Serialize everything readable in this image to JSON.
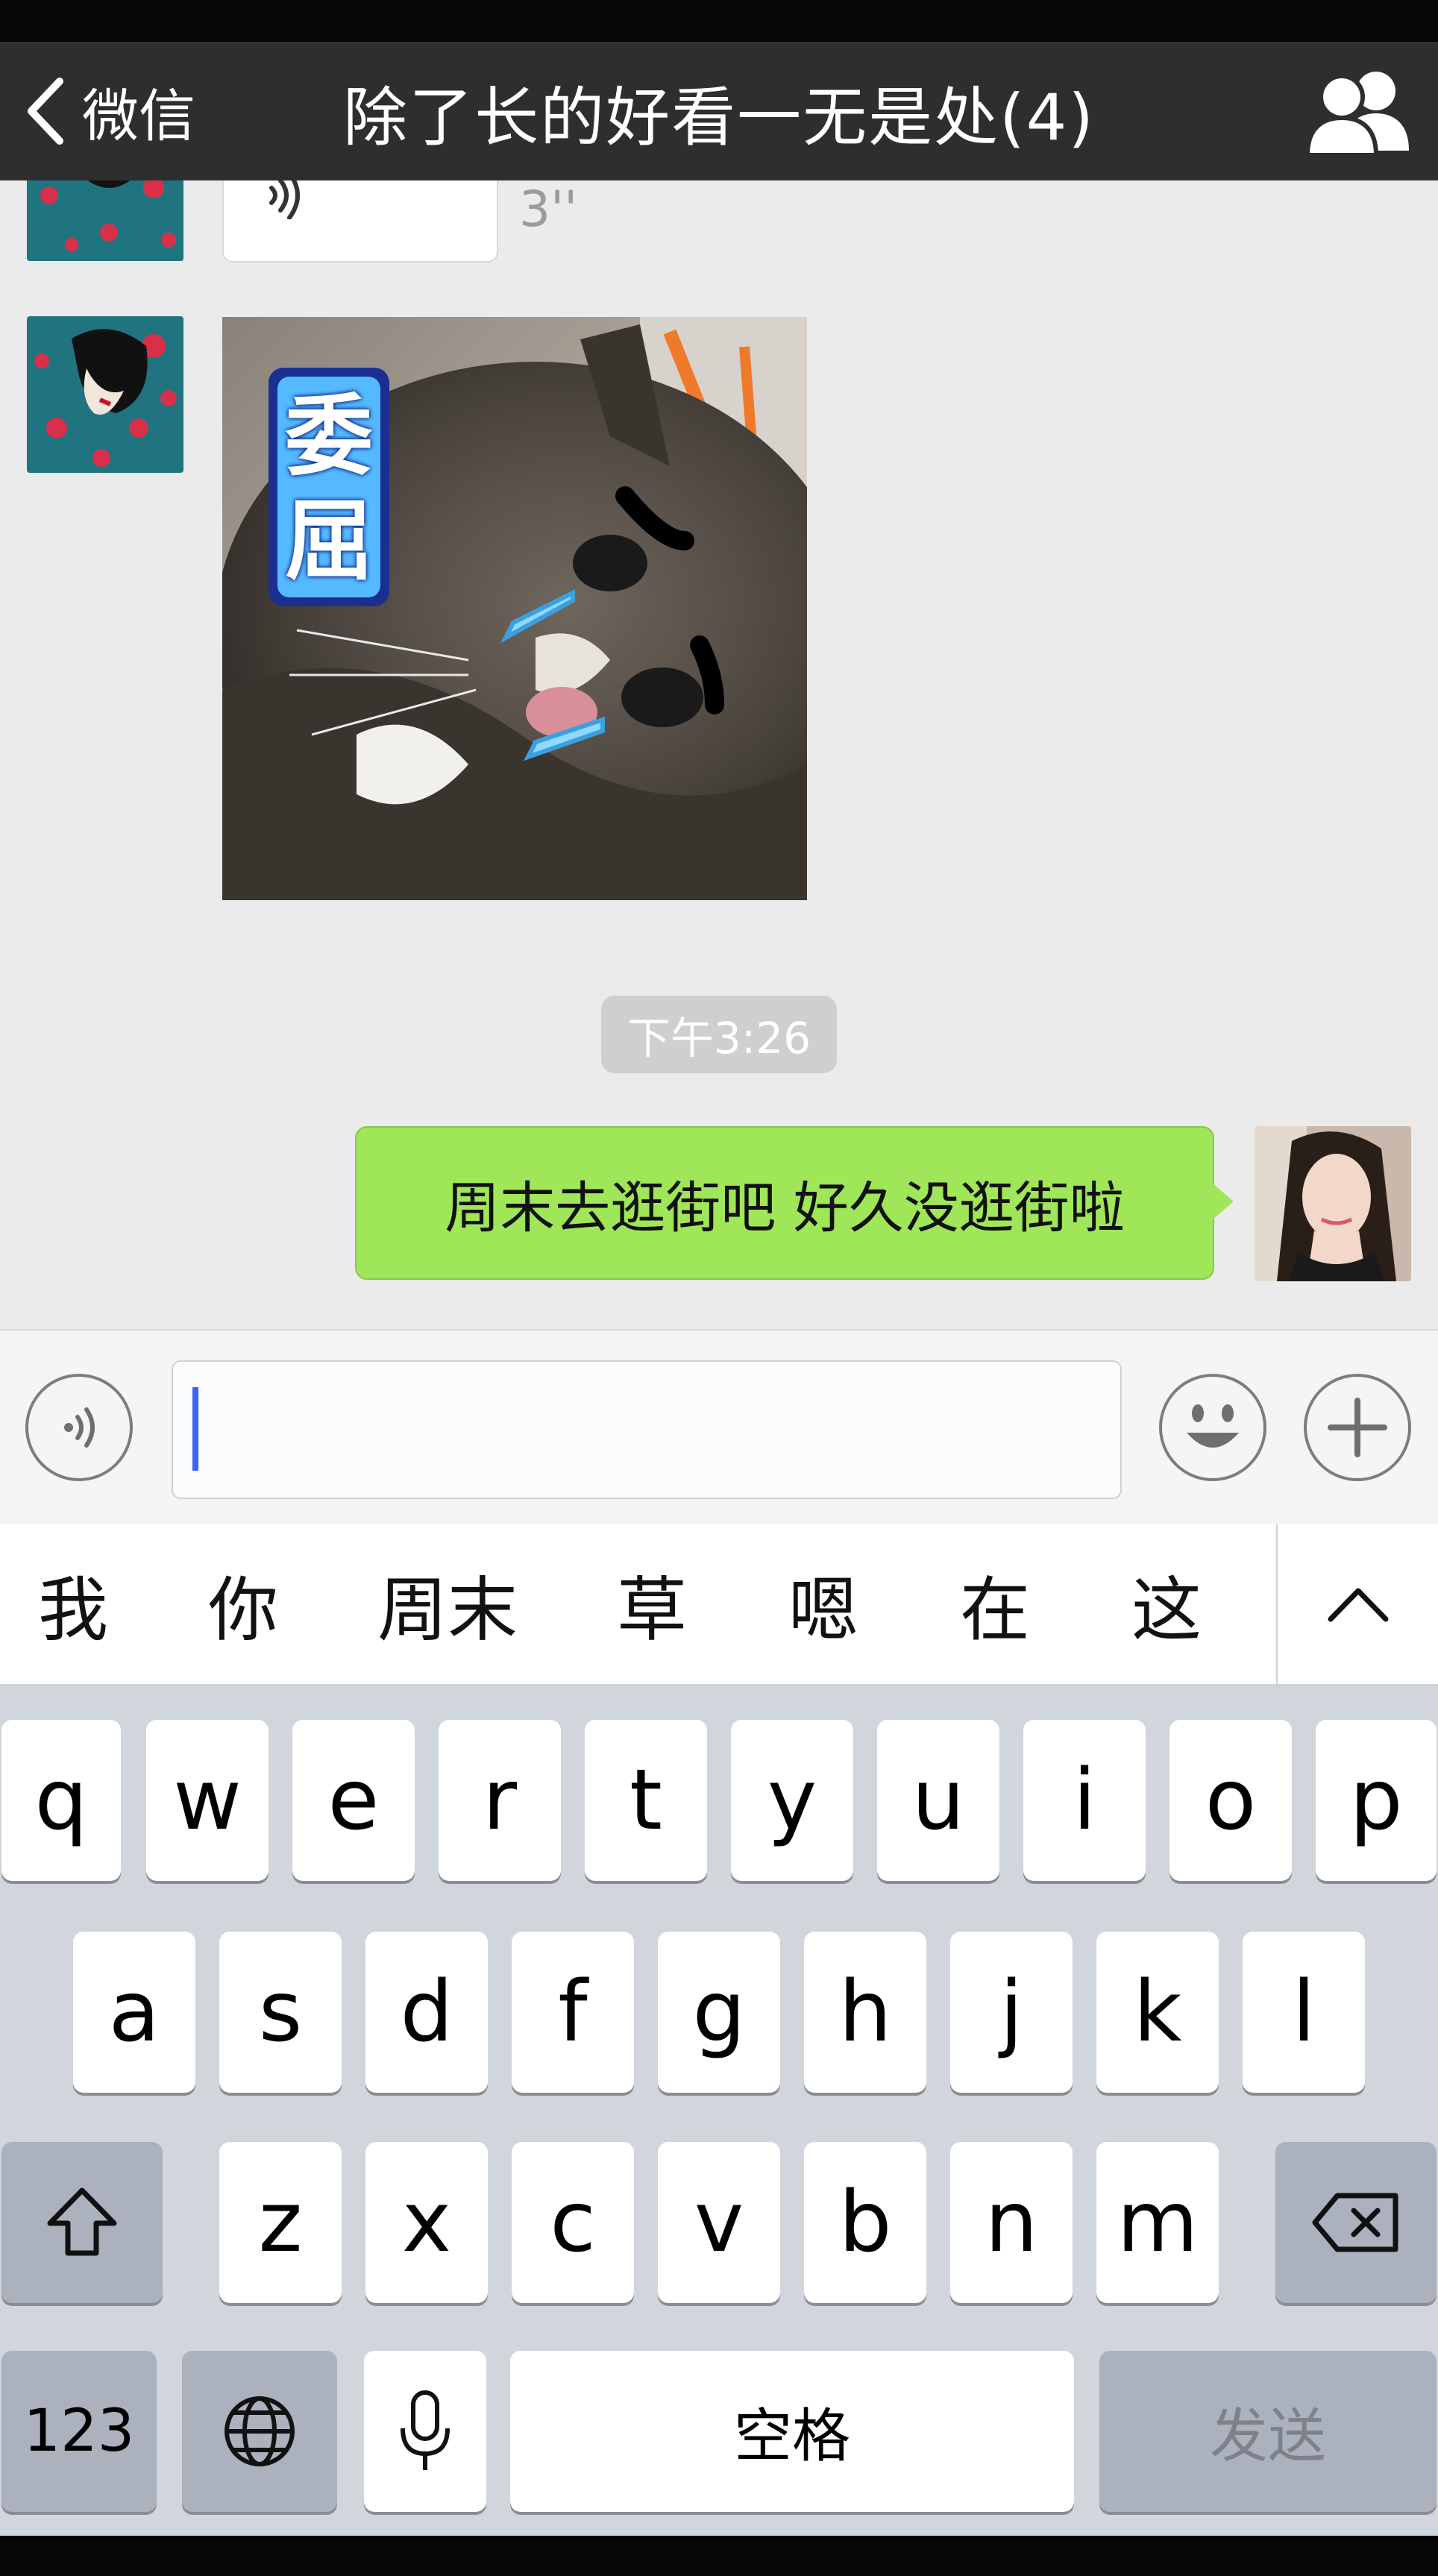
{
  "navbar": {
    "back_label": "微信",
    "title": "除了长的好看一无是处(4)"
  },
  "chat": {
    "voice_duration": "3''",
    "sticker_text": "委屈",
    "timestamp": "下午3:26",
    "outgoing_message": "周末去逛街吧 好久没逛街啦"
  },
  "candidates": [
    "我",
    "你",
    "周末",
    "草",
    "嗯",
    "在",
    "这"
  ],
  "keyboard": {
    "row1": [
      "q",
      "w",
      "e",
      "r",
      "t",
      "y",
      "u",
      "i",
      "o",
      "p"
    ],
    "row2": [
      "a",
      "s",
      "d",
      "f",
      "g",
      "h",
      "j",
      "k",
      "l"
    ],
    "row3": [
      "z",
      "x",
      "c",
      "v",
      "b",
      "n",
      "m"
    ],
    "numbers_label": "123",
    "space_label": "空格",
    "send_label": "发送"
  },
  "colors": {
    "navbar": "#2e2e30",
    "chat_background": "#ebebeb",
    "outgoing_bubble": "#9fe658",
    "caret": "#3b63f5",
    "keyboard": "#d1d5dc"
  },
  "icons": [
    "chevron-left-icon",
    "group-members-icon",
    "voice-wave-icon",
    "voice-input-icon",
    "emoji-icon",
    "plus-icon",
    "chevron-up-icon",
    "shift-icon",
    "delete-icon",
    "globe-icon",
    "microphone-icon"
  ]
}
